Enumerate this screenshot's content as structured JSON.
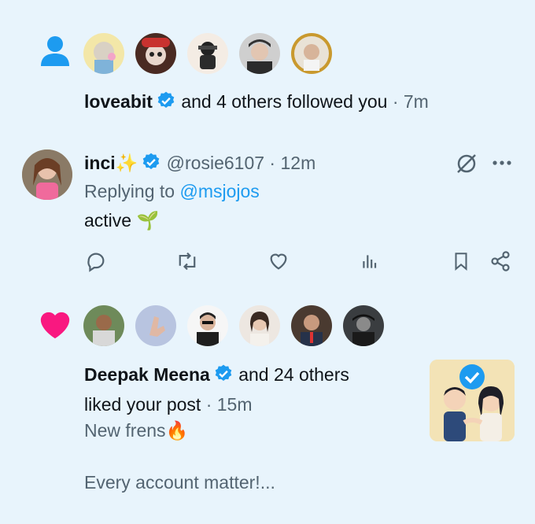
{
  "notif1": {
    "user": "loveabit",
    "text": "and 4 others followed you",
    "sep": "·",
    "time": "7m"
  },
  "tweet": {
    "name": "inci",
    "handle": "@rosie6107",
    "sep": "·",
    "time": "12m",
    "replying_prefix": "Replying to",
    "replying_to": "@msjojos",
    "body": "active 🌱"
  },
  "notif2": {
    "user": "Deepak Meena",
    "others": "and 24 others",
    "action": "liked your post",
    "sep": "·",
    "time": "15m",
    "post_line1": "New frens🔥",
    "post_line2": "Every account matter!..."
  },
  "colors": {
    "background": "#e8f4fc",
    "accent_blue": "#1d9bf0",
    "like_pink": "#f91880",
    "gray_text": "#536471"
  },
  "icons": [
    "person-icon",
    "verified-icon",
    "reply-icon",
    "retweet-icon",
    "like-icon",
    "views-icon",
    "bookmark-icon",
    "share-icon",
    "more-icon",
    "grok-icon",
    "heart-icon"
  ]
}
